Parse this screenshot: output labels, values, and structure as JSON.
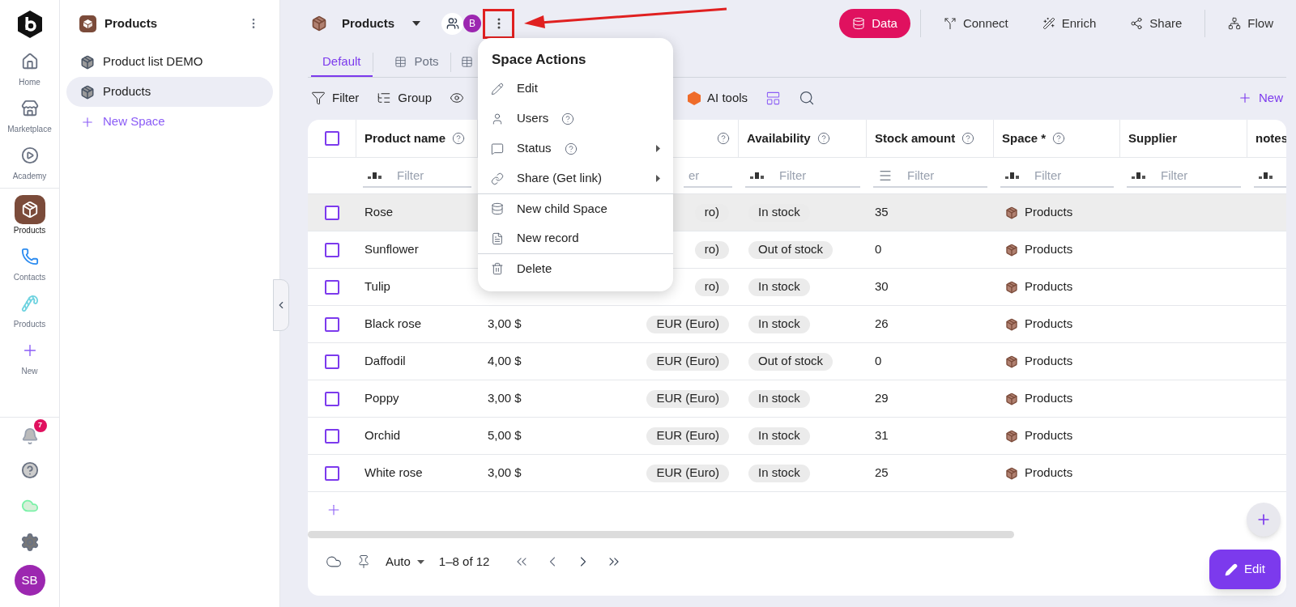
{
  "rail": {
    "items": [
      {
        "label": "Home",
        "kind": "home",
        "selected": false
      },
      {
        "label": "Marketplace",
        "kind": "store",
        "selected": false
      },
      {
        "label": "Academy",
        "kind": "play",
        "selected": false
      },
      {
        "label": "Products",
        "kind": "box",
        "selected": true
      },
      {
        "label": "Contacts",
        "kind": "phone",
        "selected": false
      },
      {
        "label": "Products",
        "kind": "candy",
        "selected": false
      },
      {
        "label": "New",
        "kind": "new",
        "selected": false
      }
    ],
    "notifications": "7",
    "avatar": "SB"
  },
  "sidebar": {
    "title": "Products",
    "items": [
      {
        "label": "Product list DEMO",
        "selected": false
      },
      {
        "label": "Products",
        "selected": true
      }
    ],
    "new_space": "New Space"
  },
  "header": {
    "title": "Products",
    "avatar": "B",
    "actions": [
      {
        "label": "Data",
        "kind": "data",
        "selected": true
      },
      {
        "label": "Connect",
        "kind": "connect",
        "selected": false
      },
      {
        "label": "Enrich",
        "kind": "enrich",
        "selected": false
      },
      {
        "label": "Share",
        "kind": "share",
        "selected": false
      },
      {
        "label": "Flow",
        "kind": "flow",
        "selected": false
      }
    ]
  },
  "tabs": [
    {
      "label": "Default",
      "selected": true
    },
    {
      "label": "Pots",
      "selected": false
    }
  ],
  "toolbar": {
    "items": [
      {
        "label": "Filter",
        "kind": "filter"
      },
      {
        "label": "Group",
        "kind": "group"
      }
    ],
    "ai_tools": "AI tools",
    "new": "New"
  },
  "table": {
    "header_checked": false,
    "columns": [
      {
        "label": "Product name",
        "help": true,
        "placeholder": "Filter",
        "kind": "text"
      },
      {
        "kind": "none"
      },
      {
        "help": true,
        "placeholder": "er"
      },
      {
        "label": "Availability",
        "help": true,
        "placeholder": "Filter",
        "kind": "text"
      },
      {
        "label": "Stock amount",
        "help": true,
        "placeholder": "Filter",
        "kind": "number"
      },
      {
        "label": "Space *",
        "help": true,
        "placeholder": "Filter",
        "kind": "text"
      },
      {
        "label": "Supplier",
        "placeholder": "Filter",
        "kind": "text"
      },
      {
        "label": "notes",
        "kind": "text"
      }
    ],
    "rows": [
      {
        "name": "Rose",
        "currency": "ro)",
        "availability": "In stock",
        "stock": "35",
        "space": "Products",
        "checked": false,
        "highlighted": true
      },
      {
        "name": "Sunflower",
        "currency": "ro)",
        "availability": "Out of stock",
        "stock": "0",
        "space": "Products",
        "checked": false,
        "highlighted": false
      },
      {
        "name": "Tulip",
        "currency": "ro)",
        "availability": "In stock",
        "stock": "30",
        "space": "Products",
        "checked": false,
        "highlighted": false
      },
      {
        "name": "Black rose",
        "price": "3,00 $",
        "currency": "EUR (Euro)",
        "availability": "In stock",
        "stock": "26",
        "space": "Products",
        "checked": false,
        "highlighted": false
      },
      {
        "name": "Daffodil",
        "price": "4,00 $",
        "currency": "EUR (Euro)",
        "availability": "Out of stock",
        "stock": "0",
        "space": "Products",
        "checked": false,
        "highlighted": false
      },
      {
        "name": "Poppy",
        "price": "3,00 $",
        "currency": "EUR (Euro)",
        "availability": "In stock",
        "stock": "29",
        "space": "Products",
        "checked": false,
        "highlighted": false
      },
      {
        "name": "Orchid",
        "price": "5,00 $",
        "currency": "EUR (Euro)",
        "availability": "In stock",
        "stock": "31",
        "space": "Products",
        "checked": false,
        "highlighted": false
      },
      {
        "name": "White rose",
        "price": "3,00 $",
        "currency": "EUR (Euro)",
        "availability": "In stock",
        "stock": "25",
        "space": "Products",
        "checked": false,
        "highlighted": false
      }
    ]
  },
  "pagination": {
    "page_size": "Auto",
    "range": "1–8 of 12"
  },
  "edit_button": "Edit",
  "menu": {
    "title": "Space Actions",
    "items": [
      {
        "label": "Edit",
        "kind": "edit",
        "help": false,
        "submenu": false,
        "divider_before": false
      },
      {
        "label": "Users",
        "kind": "users",
        "help": true,
        "submenu": false,
        "divider_before": false
      },
      {
        "label": "Status",
        "kind": "status",
        "help": true,
        "submenu": true,
        "divider_before": false
      },
      {
        "label": "Share (Get link)",
        "kind": "link",
        "help": false,
        "submenu": true,
        "divider_before": false
      },
      {
        "label": "New child Space",
        "kind": "database",
        "help": false,
        "submenu": false,
        "divider_before": true
      },
      {
        "label": "New record",
        "kind": "record",
        "help": false,
        "submenu": false,
        "divider_before": false
      },
      {
        "label": "Delete",
        "kind": "delete",
        "help": false,
        "submenu": false,
        "divider_before": true
      }
    ]
  }
}
